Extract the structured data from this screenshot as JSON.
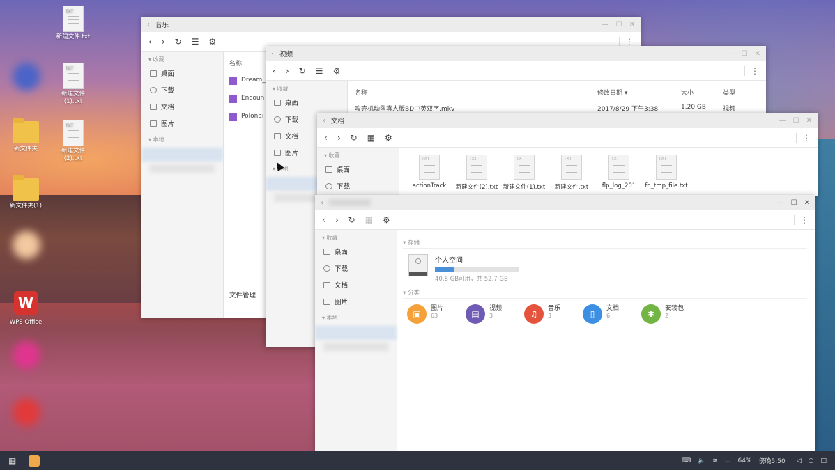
{
  "desktop": {
    "icons": [
      {
        "label": "新建文件.txt",
        "type": "txt"
      },
      {
        "label": "新建文件\n(1).txt",
        "type": "txt"
      },
      {
        "label": "新文件夹",
        "type": "folder"
      },
      {
        "label": "新建文件\n(2).txt",
        "type": "txt"
      },
      {
        "label": "新文件夹(1)",
        "type": "folder"
      },
      {
        "label": "WPS Office",
        "type": "app"
      }
    ]
  },
  "music_window": {
    "title": "音乐",
    "sidebar": {
      "fav_header": "▾ 收藏",
      "items": [
        "桌面",
        "下载",
        "文档",
        "图片"
      ],
      "local_header": "▾ 本地"
    },
    "column_name": "名称",
    "files": [
      "Dream_",
      "Encoun",
      "Polonai"
    ],
    "footer_item": "文件管理"
  },
  "video_window": {
    "title": "视频",
    "sidebar": {
      "fav_header": "▾ 收藏",
      "items": [
        "桌面",
        "下载",
        "文档",
        "图片"
      ],
      "local_header": "▾ 本地"
    },
    "columns": {
      "name": "名称",
      "date": "修改日期 ▾",
      "size": "大小",
      "type": "类型"
    },
    "row": {
      "name": "攻壳机动队真人版BD中英双字.mkv",
      "date": "2017/8/29 下午3:38",
      "size": "1.20 GB",
      "type": "视频"
    }
  },
  "docs_window": {
    "title": "文档",
    "sidebar": {
      "fav_header": "▾ 收藏",
      "items": [
        "桌面",
        "下载"
      ]
    },
    "files": [
      "actionTrack",
      "新建文件(2).txt",
      "新建文件(1).txt",
      "新建文件.txt",
      "flp_log_201",
      "fd_tmp_file.txt"
    ]
  },
  "main_window": {
    "sidebar": {
      "fav_header": "▾ 收藏",
      "items": [
        "桌面",
        "下载",
        "文档",
        "图片"
      ],
      "local_header": "▾ 本地"
    },
    "storage_header": "▾ 存储",
    "storage": {
      "name": "个人空间",
      "detail": "40.8 GB可用，共 52.7 GB",
      "used_fraction": 0.23
    },
    "category_header": "▾ 分类",
    "categories": [
      {
        "label": "图片",
        "count": "63",
        "color": "#f5a13a",
        "icon": "image-icon"
      },
      {
        "label": "视频",
        "count": "3",
        "color": "#6f5bb5",
        "icon": "video-icon"
      },
      {
        "label": "音乐",
        "count": "3",
        "color": "#e5533d",
        "icon": "music-icon"
      },
      {
        "label": "文档",
        "count": "6",
        "color": "#3c8fe3",
        "icon": "document-icon"
      },
      {
        "label": "安装包",
        "count": "2",
        "color": "#73b544",
        "icon": "android-icon"
      }
    ]
  },
  "taskbar": {
    "battery": "64%",
    "time": "傍晚5:50"
  },
  "colors": {
    "accent": "#4a90d9",
    "taskbar": "#2f3340"
  }
}
